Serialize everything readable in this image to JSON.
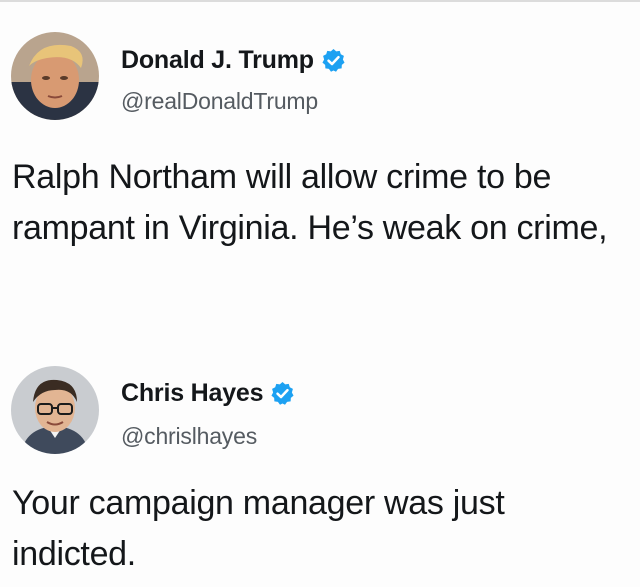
{
  "tweets": [
    {
      "display_name": "Donald J. Trump",
      "handle": "@realDonaldTrump",
      "text": "Ralph Northam will allow crime to be rampant in Virginia. He’s weak on crime,",
      "avatar_icon": "profile-photo-icon",
      "verified_icon": "verified-badge-icon"
    },
    {
      "display_name": "Chris Hayes",
      "handle": "@chrislhayes",
      "text": "Your campaign manager was just indicted.",
      "avatar_icon": "profile-photo-icon",
      "verified_icon": "verified-badge-icon"
    }
  ],
  "colors": {
    "verified_blue": "#1da1f2",
    "handle_gray": "#555b61",
    "text": "#14171a"
  }
}
